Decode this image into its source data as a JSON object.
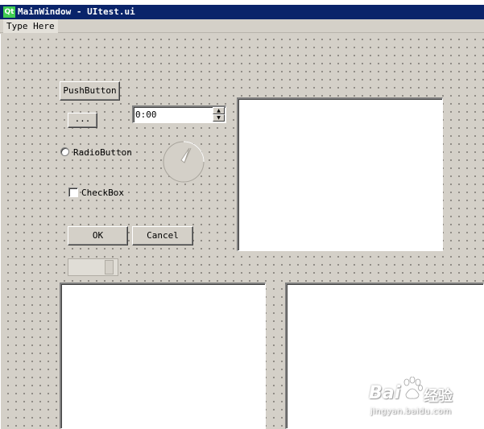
{
  "window": {
    "title": "MainWindow - UItest.ui",
    "logo": "Qt"
  },
  "menubar": {
    "items": [
      {
        "label": "Type Here"
      }
    ]
  },
  "widgets": {
    "push_button": {
      "label": "PushButton"
    },
    "tool_button": {
      "label": "..."
    },
    "time_edit": {
      "value": "0:00",
      "up_arrow": "▲",
      "down_arrow": "▼"
    },
    "radio_button": {
      "label": "RadioButton",
      "checked": false
    },
    "check_box": {
      "label": "CheckBox",
      "checked": false
    },
    "ok_button": {
      "label": "OK"
    },
    "cancel_button": {
      "label": "Cancel"
    },
    "dial": {
      "value_fraction": 0.6
    },
    "scroll_bar": {
      "disabled": true
    }
  },
  "watermark": {
    "brand_text": "Bai",
    "brand_suffix": "经验",
    "url": "jingyan.baidu.com"
  },
  "colors": {
    "titlebar": "#0a246a",
    "face": "#d4d0c8",
    "qt_logo": "#41cd52"
  },
  "icons": {
    "logo": "qt-logo-icon",
    "paw": "paw-icon",
    "radio": "radio-circle-icon",
    "checkbox": "checkbox-square-icon"
  }
}
